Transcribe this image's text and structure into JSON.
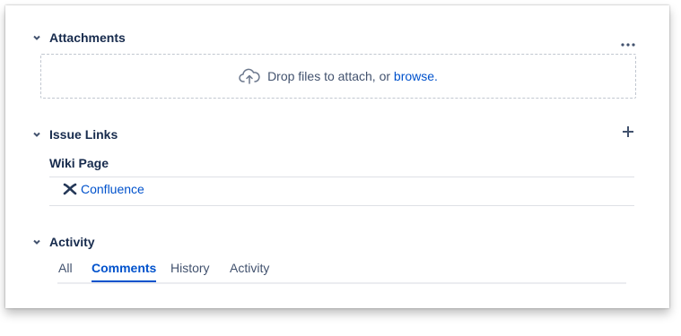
{
  "attachments": {
    "title": "Attachments",
    "more_icon": "more-horizontal-icon",
    "dropzone": {
      "icon": "cloud-upload-icon",
      "text": "Drop files to attach, or",
      "browse_link": "browse."
    }
  },
  "issue_links": {
    "title": "Issue Links",
    "add_icon": "plus-icon",
    "group_label": "Wiki Page",
    "items": [
      {
        "icon": "confluence-icon",
        "label": "Confluence"
      }
    ]
  },
  "activity": {
    "title": "Activity",
    "tabs": [
      {
        "label": "All",
        "active": false
      },
      {
        "label": "Comments",
        "active": true
      },
      {
        "label": "History",
        "active": false
      },
      {
        "label": "Activity",
        "active": false
      }
    ]
  },
  "colors": {
    "text": "#172b4d",
    "link": "#0052cc",
    "muted": "#42526e",
    "border": "#dfe1e6"
  }
}
